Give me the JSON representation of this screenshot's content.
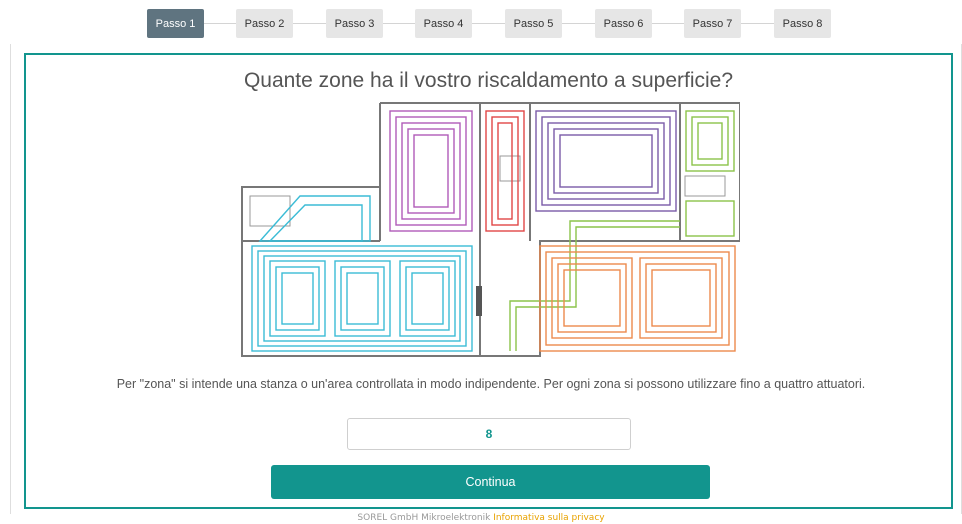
{
  "stepper": {
    "steps": [
      "Passo 1",
      "Passo 2",
      "Passo 3",
      "Passo 4",
      "Passo 5",
      "Passo 6",
      "Passo 7",
      "Passo 8"
    ],
    "active_index": 0,
    "active_color": "#5f7480",
    "inactive_color": "#e6e6e6"
  },
  "main": {
    "title": "Quante zone ha il vostro riscaldamento a superficie?",
    "description": "Per \"zona\" si intende una stanza o un'area controllata in modo indipendente. Per ogni zona si possono utilizzare fino a quattro attuatori.",
    "zones_value": "8",
    "continue_label": "Continua",
    "accent_color": "#12958e",
    "zone_colors": [
      "#3bbcd6",
      "#b05bb8",
      "#e04646",
      "#7b5ba8",
      "#8bc34a",
      "#ec8a4d"
    ]
  },
  "footer": {
    "company": "SOREL GmbH Mikroelektronik",
    "privacy_link": "Informativa sulla privacy"
  }
}
